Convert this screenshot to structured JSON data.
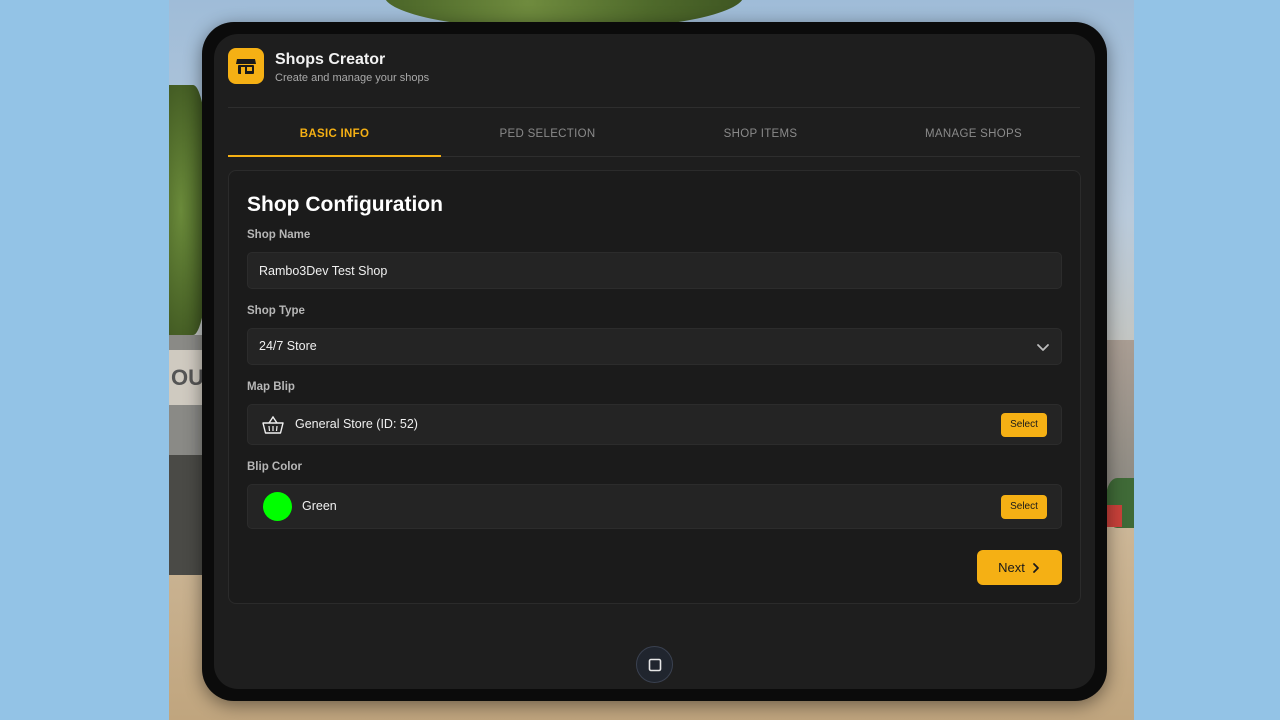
{
  "app": {
    "title": "Shops Creator",
    "subtitle": "Create and manage your shops",
    "logo_icon": "shop-icon",
    "accent_color": "#f5b014"
  },
  "tabs": [
    {
      "label": "BASIC INFO",
      "active": true
    },
    {
      "label": "PED SELECTION",
      "active": false
    },
    {
      "label": "SHOP ITEMS",
      "active": false
    },
    {
      "label": "MANAGE SHOPS",
      "active": false
    }
  ],
  "form": {
    "title": "Shop Configuration",
    "shop_name": {
      "label": "Shop Name",
      "value": "Rambo3Dev Test Shop"
    },
    "shop_type": {
      "label": "Shop Type",
      "value": "24/7 Store",
      "icon": "chevron-down-icon"
    },
    "map_blip": {
      "label": "Map Blip",
      "value": "General Store (ID: 52)",
      "icon": "basket-icon",
      "button_label": "Select"
    },
    "blip_color": {
      "label": "Blip Color",
      "value": "Green",
      "swatch_color": "#00ff00",
      "button_label": "Select"
    },
    "next_label": "Next"
  },
  "home_button": {
    "icon": "home-square-icon"
  }
}
